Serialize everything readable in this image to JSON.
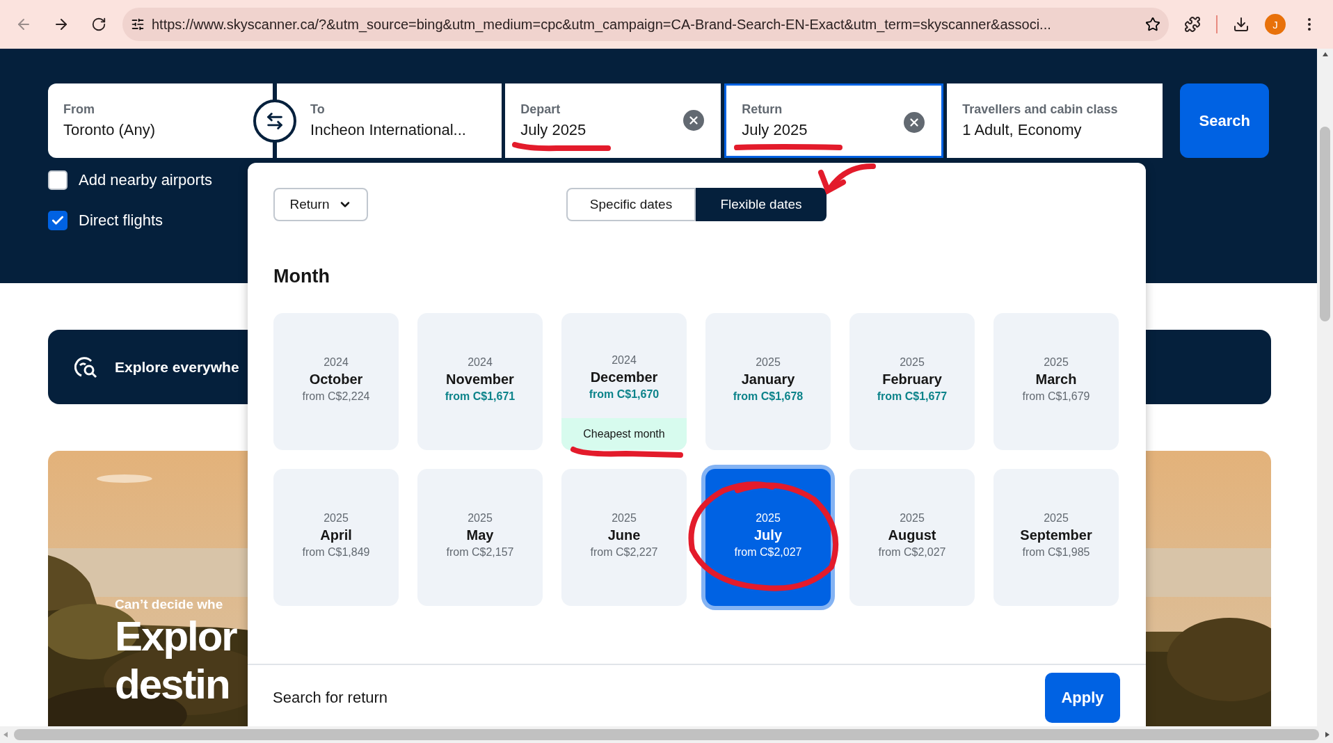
{
  "browser": {
    "url": "https://www.skyscanner.ca/?&utm_source=bing&utm_medium=cpc&utm_campaign=CA-Brand-Search-EN-Exact&utm_term=skyscanner&associ...",
    "profile_initial": "J"
  },
  "search": {
    "fields": [
      {
        "kind": "place",
        "label": "From",
        "value": "Toronto (Any)",
        "active": false
      },
      {
        "kind": "place",
        "label": "To",
        "value": "Incheon International...",
        "active": false
      },
      {
        "kind": "date",
        "label": "Depart",
        "value": "July 2025",
        "active": false
      },
      {
        "kind": "date",
        "label": "Return",
        "value": "July 2025",
        "active": true
      },
      {
        "kind": "travellers",
        "label": "Travellers and cabin class",
        "value": "1 Adult, Economy",
        "active": false
      }
    ],
    "button": "Search"
  },
  "options": [
    {
      "label": "Add nearby airports",
      "checked": false
    },
    {
      "label": "Direct flights",
      "checked": true
    }
  ],
  "explore_banner": {
    "text": "Explore everywhe"
  },
  "promo": {
    "subtitle": "Can’t decide whe",
    "title_lines": [
      "Explor",
      "destin"
    ]
  },
  "date_picker": {
    "trip_type": "Return",
    "modes": [
      {
        "label": "Specific dates",
        "selected": false
      },
      {
        "label": "Flexible dates",
        "selected": true
      }
    ],
    "heading": "Month",
    "months": [
      {
        "year": "2024",
        "month": "October",
        "price": "from C$2,224",
        "cheap": false,
        "selected": false
      },
      {
        "year": "2024",
        "month": "November",
        "price": "from C$1,671",
        "cheap": true,
        "selected": false
      },
      {
        "year": "2024",
        "month": "December",
        "price": "from C$1,670",
        "cheap": true,
        "selected": false,
        "badge": "Cheapest month"
      },
      {
        "year": "2025",
        "month": "January",
        "price": "from C$1,678",
        "cheap": true,
        "selected": false
      },
      {
        "year": "2025",
        "month": "February",
        "price": "from C$1,677",
        "cheap": true,
        "selected": false
      },
      {
        "year": "2025",
        "month": "March",
        "price": "from C$1,679",
        "cheap": false,
        "selected": false
      },
      {
        "year": "2025",
        "month": "April",
        "price": "from C$1,849",
        "cheap": false,
        "selected": false
      },
      {
        "year": "2025",
        "month": "May",
        "price": "from C$2,157",
        "cheap": false,
        "selected": false
      },
      {
        "year": "2025",
        "month": "June",
        "price": "from C$2,227",
        "cheap": false,
        "selected": false
      },
      {
        "year": "2025",
        "month": "July",
        "price": "from C$2,027",
        "cheap": false,
        "selected": true
      },
      {
        "year": "2025",
        "month": "August",
        "price": "from C$2,027",
        "cheap": false,
        "selected": false
      },
      {
        "year": "2025",
        "month": "September",
        "price": "from C$1,985",
        "cheap": false,
        "selected": false
      }
    ],
    "footer_text": "Search for return",
    "apply": "Apply"
  }
}
